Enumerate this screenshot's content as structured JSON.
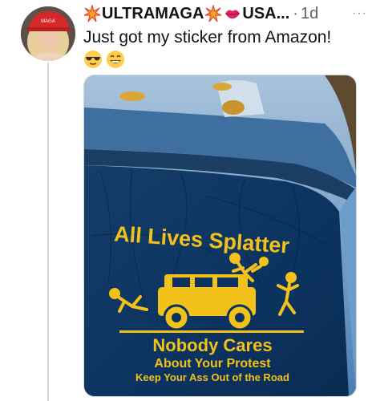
{
  "tweet": {
    "author": {
      "name_part1": "ULTRAMAGA",
      "name_part2": "USA...",
      "avatar_icon": "avatar",
      "name_icons": [
        "collision-icon",
        "collision-icon",
        "lips-icon"
      ]
    },
    "separator": "·",
    "timestamp": "1d",
    "more_label": "···",
    "text": "Just got my sticker from Amazon!",
    "reaction_emojis": [
      "sunglasses-face-icon",
      "grinning-face-icon"
    ]
  },
  "media": {
    "sticker": {
      "headline": "All Lives Splatter",
      "line1": "Nobody Cares",
      "line2": "About Your Protest",
      "line3": "Keep Your Ass Out of the Road"
    },
    "colors": {
      "sticker_yellow": "#f2c21b",
      "window_blue": "#0b3a66",
      "car_paint": "#5b8fc2"
    }
  }
}
